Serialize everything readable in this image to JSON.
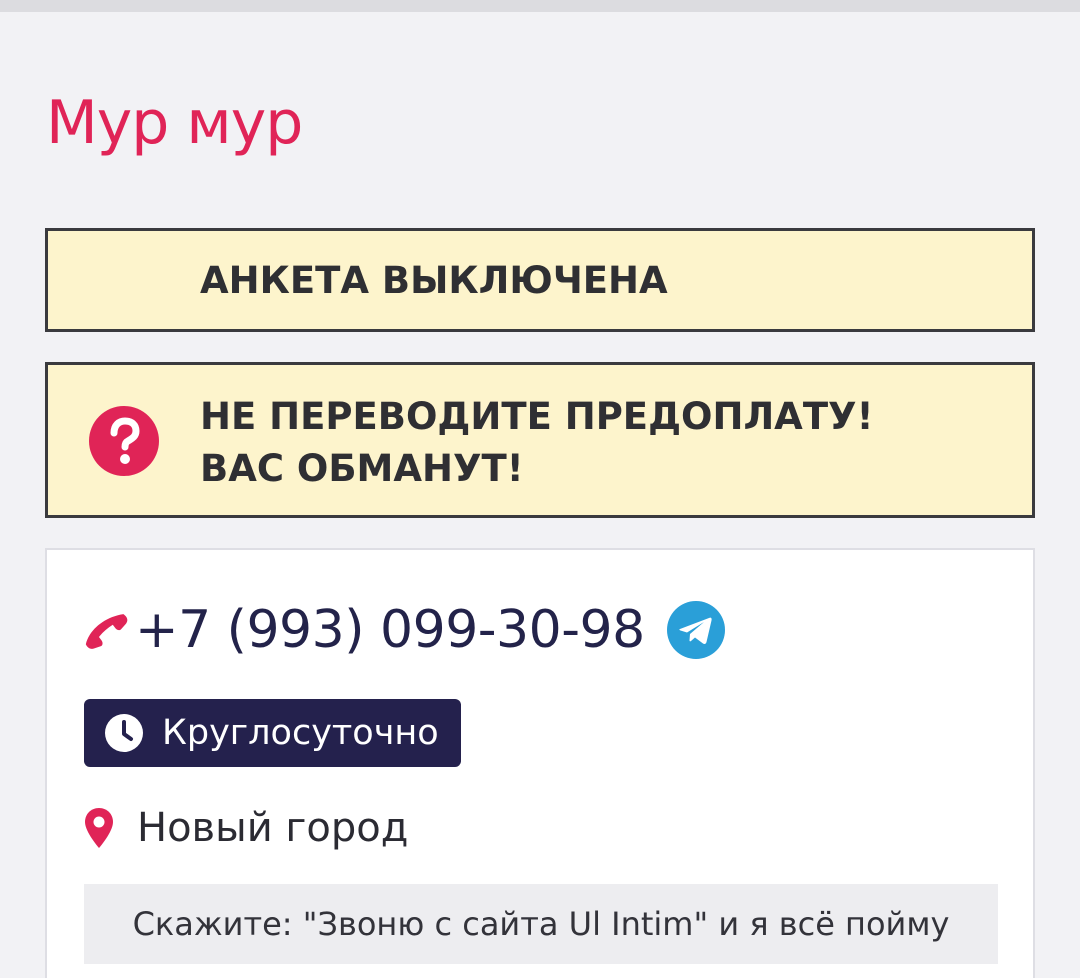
{
  "profile": {
    "name": "Мур мур"
  },
  "notices": {
    "disabled": "АНКЕТА ВЫКЛЮЧЕНА",
    "warning_line1": "НЕ ПЕРЕВОДИТЕ ПРЕДОПЛАТУ!",
    "warning_line2": "ВАС ОБМАНУТ!"
  },
  "contact": {
    "phone": "+7 (993) 099-30-98",
    "hours": "Круглосуточно",
    "location": "Новый город",
    "tip": "Скажите: \"Звоню с сайта Ul Intim\" и я всё пойму"
  },
  "icons": {
    "help": "question-circle-icon",
    "phone": "phone-icon",
    "telegram": "telegram-icon",
    "clock": "clock-icon",
    "location": "map-pin-icon"
  },
  "colors": {
    "accent": "#e02457",
    "notice_background": "#fdf4cc",
    "badge_background": "#24214d",
    "telegram": "#2a9fd8"
  }
}
